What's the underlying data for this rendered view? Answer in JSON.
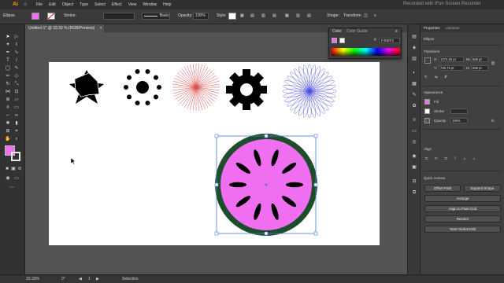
{
  "menubar": {
    "logo": "Ai",
    "items": [
      "File",
      "Edit",
      "Object",
      "Type",
      "Select",
      "Effect",
      "View",
      "Window",
      "Help"
    ],
    "watermark": "Recorded with iFun Screen Recorder"
  },
  "controlbar": {
    "selection_label": "Ellipse",
    "fill_color": "#f06ef0",
    "stroke_label": "Stroke:",
    "brush_label": "Basic",
    "opacity_label": "Opacity:",
    "opacity_value": "100%",
    "style_label": "Style:",
    "shape_label": "Shape:",
    "transform_label": "Transform"
  },
  "document": {
    "tab_title": "Untitled-1* @ 33.33 % (RGB/Preview)"
  },
  "color_panel": {
    "tab_color": "Color",
    "tab_guide": "Color Guide",
    "hex_label": "#",
    "hex_value": "F45EF2"
  },
  "properties": {
    "tab_properties": "Properties",
    "tab_libraries": "Libraries",
    "selection": "Ellipse",
    "transform_title": "Transform",
    "x_label": "X:",
    "x_value": "1274.25 pt",
    "y_label": "Y:",
    "y_value": "725.75 pt",
    "w_label": "W:",
    "w_value": "568 pt",
    "h_label": "H:",
    "h_value": "568 pt",
    "appearance_title": "Appearance",
    "fill_label": "Fill",
    "stroke_label": "Stroke",
    "stroke_value": "",
    "opacity_label": "Opacity",
    "opacity_value": "100%",
    "align_title": "Align",
    "quick_actions_title": "Quick Actions",
    "offset_path": "Offset Path",
    "expand_shape": "Expand Shape",
    "arrange": "Arrange",
    "align_pixel": "Align to Pixel Grid",
    "recolor": "Recolor",
    "global_edit": "Start Global Edit"
  },
  "statusbar": {
    "zoom": "33.33%",
    "rotation": "0°",
    "artboard_num": "1",
    "tool": "Selection"
  },
  "colors": {
    "watermelon_fill": "#f06ef0",
    "watermelon_rind": "#1e4d2b",
    "radial_red": "#d9534f",
    "radial_blue": "#4a4fd9",
    "selection_blue": "#4a7cd9"
  }
}
